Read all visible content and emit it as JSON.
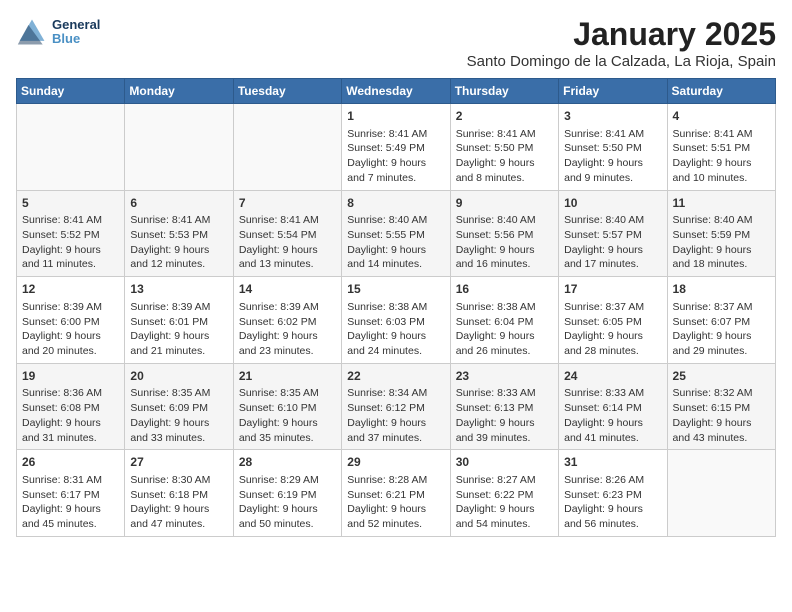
{
  "logo": {
    "line1": "General",
    "line2": "Blue"
  },
  "title": "January 2025",
  "location": "Santo Domingo de la Calzada, La Rioja, Spain",
  "weekdays": [
    "Sunday",
    "Monday",
    "Tuesday",
    "Wednesday",
    "Thursday",
    "Friday",
    "Saturday"
  ],
  "weeks": [
    [
      {
        "day": "",
        "info": ""
      },
      {
        "day": "",
        "info": ""
      },
      {
        "day": "",
        "info": ""
      },
      {
        "day": "1",
        "info": "Sunrise: 8:41 AM\nSunset: 5:49 PM\nDaylight: 9 hours and 7 minutes."
      },
      {
        "day": "2",
        "info": "Sunrise: 8:41 AM\nSunset: 5:50 PM\nDaylight: 9 hours and 8 minutes."
      },
      {
        "day": "3",
        "info": "Sunrise: 8:41 AM\nSunset: 5:50 PM\nDaylight: 9 hours and 9 minutes."
      },
      {
        "day": "4",
        "info": "Sunrise: 8:41 AM\nSunset: 5:51 PM\nDaylight: 9 hours and 10 minutes."
      }
    ],
    [
      {
        "day": "5",
        "info": "Sunrise: 8:41 AM\nSunset: 5:52 PM\nDaylight: 9 hours and 11 minutes."
      },
      {
        "day": "6",
        "info": "Sunrise: 8:41 AM\nSunset: 5:53 PM\nDaylight: 9 hours and 12 minutes."
      },
      {
        "day": "7",
        "info": "Sunrise: 8:41 AM\nSunset: 5:54 PM\nDaylight: 9 hours and 13 minutes."
      },
      {
        "day": "8",
        "info": "Sunrise: 8:40 AM\nSunset: 5:55 PM\nDaylight: 9 hours and 14 minutes."
      },
      {
        "day": "9",
        "info": "Sunrise: 8:40 AM\nSunset: 5:56 PM\nDaylight: 9 hours and 16 minutes."
      },
      {
        "day": "10",
        "info": "Sunrise: 8:40 AM\nSunset: 5:57 PM\nDaylight: 9 hours and 17 minutes."
      },
      {
        "day": "11",
        "info": "Sunrise: 8:40 AM\nSunset: 5:59 PM\nDaylight: 9 hours and 18 minutes."
      }
    ],
    [
      {
        "day": "12",
        "info": "Sunrise: 8:39 AM\nSunset: 6:00 PM\nDaylight: 9 hours and 20 minutes."
      },
      {
        "day": "13",
        "info": "Sunrise: 8:39 AM\nSunset: 6:01 PM\nDaylight: 9 hours and 21 minutes."
      },
      {
        "day": "14",
        "info": "Sunrise: 8:39 AM\nSunset: 6:02 PM\nDaylight: 9 hours and 23 minutes."
      },
      {
        "day": "15",
        "info": "Sunrise: 8:38 AM\nSunset: 6:03 PM\nDaylight: 9 hours and 24 minutes."
      },
      {
        "day": "16",
        "info": "Sunrise: 8:38 AM\nSunset: 6:04 PM\nDaylight: 9 hours and 26 minutes."
      },
      {
        "day": "17",
        "info": "Sunrise: 8:37 AM\nSunset: 6:05 PM\nDaylight: 9 hours and 28 minutes."
      },
      {
        "day": "18",
        "info": "Sunrise: 8:37 AM\nSunset: 6:07 PM\nDaylight: 9 hours and 29 minutes."
      }
    ],
    [
      {
        "day": "19",
        "info": "Sunrise: 8:36 AM\nSunset: 6:08 PM\nDaylight: 9 hours and 31 minutes."
      },
      {
        "day": "20",
        "info": "Sunrise: 8:35 AM\nSunset: 6:09 PM\nDaylight: 9 hours and 33 minutes."
      },
      {
        "day": "21",
        "info": "Sunrise: 8:35 AM\nSunset: 6:10 PM\nDaylight: 9 hours and 35 minutes."
      },
      {
        "day": "22",
        "info": "Sunrise: 8:34 AM\nSunset: 6:12 PM\nDaylight: 9 hours and 37 minutes."
      },
      {
        "day": "23",
        "info": "Sunrise: 8:33 AM\nSunset: 6:13 PM\nDaylight: 9 hours and 39 minutes."
      },
      {
        "day": "24",
        "info": "Sunrise: 8:33 AM\nSunset: 6:14 PM\nDaylight: 9 hours and 41 minutes."
      },
      {
        "day": "25",
        "info": "Sunrise: 8:32 AM\nSunset: 6:15 PM\nDaylight: 9 hours and 43 minutes."
      }
    ],
    [
      {
        "day": "26",
        "info": "Sunrise: 8:31 AM\nSunset: 6:17 PM\nDaylight: 9 hours and 45 minutes."
      },
      {
        "day": "27",
        "info": "Sunrise: 8:30 AM\nSunset: 6:18 PM\nDaylight: 9 hours and 47 minutes."
      },
      {
        "day": "28",
        "info": "Sunrise: 8:29 AM\nSunset: 6:19 PM\nDaylight: 9 hours and 50 minutes."
      },
      {
        "day": "29",
        "info": "Sunrise: 8:28 AM\nSunset: 6:21 PM\nDaylight: 9 hours and 52 minutes."
      },
      {
        "day": "30",
        "info": "Sunrise: 8:27 AM\nSunset: 6:22 PM\nDaylight: 9 hours and 54 minutes."
      },
      {
        "day": "31",
        "info": "Sunrise: 8:26 AM\nSunset: 6:23 PM\nDaylight: 9 hours and 56 minutes."
      },
      {
        "day": "",
        "info": ""
      }
    ]
  ]
}
